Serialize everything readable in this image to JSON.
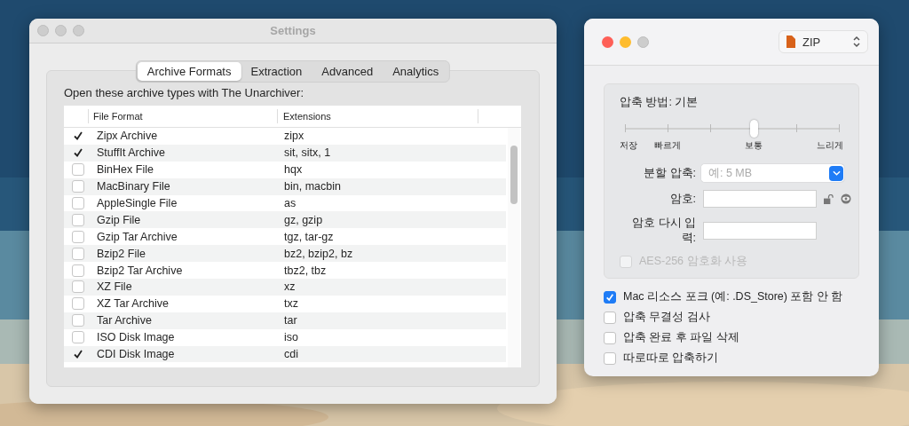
{
  "settings_window": {
    "title": "Settings",
    "tabs": [
      {
        "label": "Archive Formats",
        "selected": true
      },
      {
        "label": "Extraction",
        "selected": false
      },
      {
        "label": "Advanced",
        "selected": false
      },
      {
        "label": "Analytics",
        "selected": false
      }
    ],
    "intro": "Open these archive types with The Unarchiver:",
    "table": {
      "columns": [
        "File Format",
        "Extensions"
      ],
      "rows": [
        {
          "checked": true,
          "format": "Zipx Archive",
          "extensions": "zipx"
        },
        {
          "checked": true,
          "format": "StuffIt Archive",
          "extensions": "sit, sitx, 1"
        },
        {
          "checked": false,
          "format": "BinHex File",
          "extensions": "hqx"
        },
        {
          "checked": false,
          "format": "MacBinary File",
          "extensions": "bin, macbin"
        },
        {
          "checked": false,
          "format": "AppleSingle File",
          "extensions": "as"
        },
        {
          "checked": false,
          "format": "Gzip File",
          "extensions": "gz, gzip"
        },
        {
          "checked": false,
          "format": "Gzip Tar Archive",
          "extensions": "tgz, tar-gz"
        },
        {
          "checked": false,
          "format": "Bzip2 File",
          "extensions": "bz2, bzip2, bz"
        },
        {
          "checked": false,
          "format": "Bzip2 Tar Archive",
          "extensions": "tbz2, tbz"
        },
        {
          "checked": false,
          "format": "XZ File",
          "extensions": "xz"
        },
        {
          "checked": false,
          "format": "XZ Tar Archive",
          "extensions": "txz"
        },
        {
          "checked": false,
          "format": "Tar Archive",
          "extensions": "tar"
        },
        {
          "checked": false,
          "format": "ISO Disk Image",
          "extensions": "iso"
        },
        {
          "checked": true,
          "format": "CDI Disk Image",
          "extensions": "cdi"
        }
      ]
    }
  },
  "archive_window": {
    "format_menu": "ZIP",
    "method_label": "압축 방법: 기본",
    "slider": {
      "level": 0.6,
      "ticks": [
        {
          "label": "저장"
        },
        {
          "label": "빠르게"
        },
        {
          "label": "보통"
        },
        {
          "label": "느리게"
        }
      ]
    },
    "split": {
      "label": "분할 압축:",
      "placeholder": "예: 5 MB"
    },
    "password": {
      "label": "암호:"
    },
    "password_again": {
      "label": "암호 다시 입력:"
    },
    "aes": {
      "label": "AES-256 암호화 사용",
      "checked": false,
      "disabled": true
    },
    "options": [
      {
        "label": "Mac 리소스 포크 (예: .DS_Store) 포함 안 함",
        "checked": true
      },
      {
        "label": "압축 무결성 검사",
        "checked": false
      },
      {
        "label": "압축 완료 후 파일 삭제",
        "checked": false
      },
      {
        "label": "따로따로 압축하기",
        "checked": false
      }
    ]
  }
}
